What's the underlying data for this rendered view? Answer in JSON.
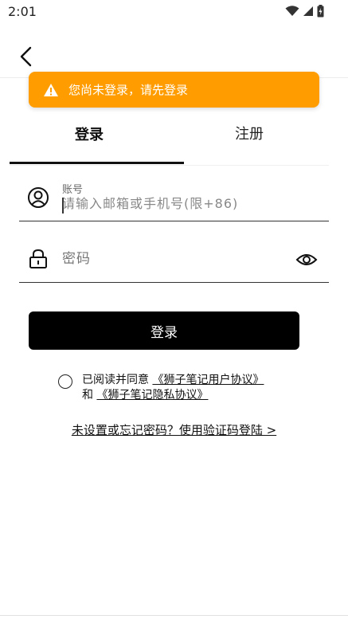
{
  "status_bar": {
    "time": "2:01"
  },
  "toast": {
    "message": "您尚未登录，请先登录"
  },
  "tabs": {
    "login": "登录",
    "register": "注册"
  },
  "account_field": {
    "label": "账号",
    "placeholder": "请输入邮箱或手机号(限+86)"
  },
  "password_field": {
    "placeholder": "密码"
  },
  "login_button": "登录",
  "agreement": {
    "prefix": "已阅读并同意",
    "user_agreement": "《狮子笔记用户协议》",
    "conjunction": "和",
    "privacy_policy": "《狮子笔记隐私协议》"
  },
  "forgot_link": "未设置或忘记密码？使用验证码登陆 >",
  "colors": {
    "toast_bg": "#ff9d00",
    "button_bg": "#000000"
  }
}
